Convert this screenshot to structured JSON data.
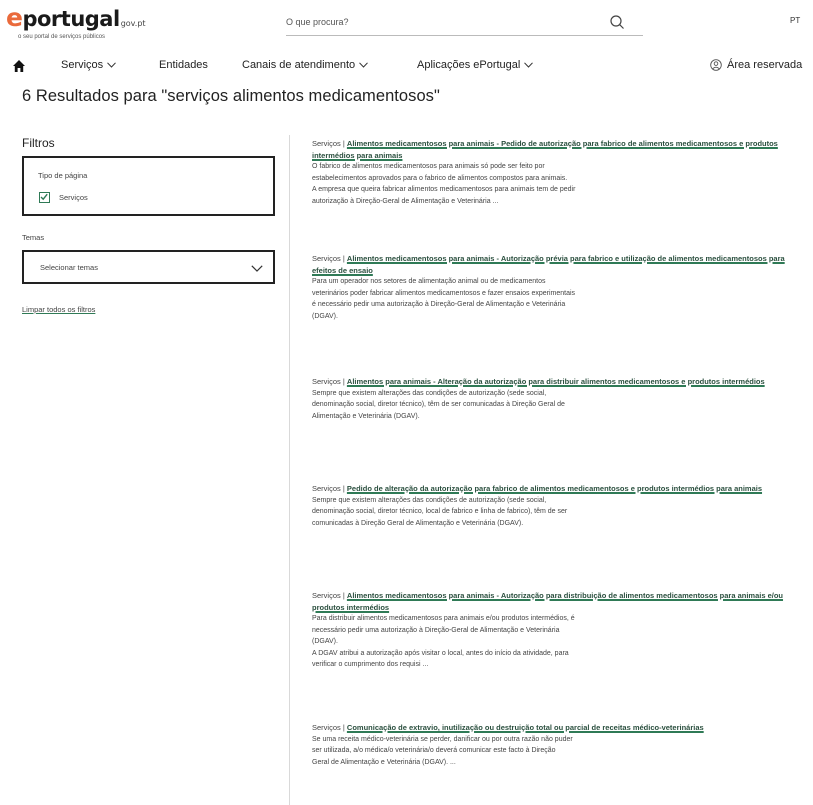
{
  "header": {
    "logo_e": "e",
    "logo_text": "portugal",
    "logo_suffix": "gov.pt",
    "logo_tagline": "o seu portal de serviços públicos",
    "search_placeholder": "O que procura?",
    "search_icon": "search-icon",
    "language": "PT"
  },
  "nav": {
    "home_icon": "home-icon",
    "items": [
      {
        "label": "Serviços",
        "has_dropdown": true
      },
      {
        "label": "Entidades",
        "has_dropdown": false
      },
      {
        "label": "Canais de atendimento",
        "has_dropdown": true
      },
      {
        "label": "Aplicações ePortugal",
        "has_dropdown": true
      }
    ],
    "reserved_area": "Área reservada",
    "reserved_icon": "user-icon"
  },
  "results_heading": "6 Resultados para \"serviços alimentos medicamentosos\"",
  "filters": {
    "title": "Filtros",
    "page_type_label": "Tipo de página",
    "page_type_option": "Serviços",
    "page_type_checked": true,
    "themes_label": "Temas",
    "themes_select": "Selecionar temas",
    "clear_all": "Limpar todos os filtros"
  },
  "results": [
    {
      "category": "Serviços",
      "separator": "|",
      "title": "Alimentos medicamentosos para animais - Pedido de autorização para fabrico de alimentos medicamentosos e produtos intermédios para animais",
      "description": "O fabrico de alimentos medicamentosos para animais só pode ser feito por\nestabelecimentos aprovados para o fabrico de alimentos compostos para animais.\nA empresa que queira fabricar alimentos medicamentosos para animais tem de pedir\nautorização à Direção-Geral de Alimentação e Veterinária ..."
    },
    {
      "category": "Serviços",
      "separator": "|",
      "title": "Alimentos medicamentosos para animais - Autorização prévia para fabrico e utilização de alimentos medicamentosos para efeitos de ensaio",
      "description": "Para um operador nos setores de alimentação animal ou de medicamentos\nveterinários poder fabricar alimentos medicamentosos e fazer ensaios experimentais\né necessário pedir uma autorização à Direção-Geral de Alimentação e Veterinária\n(DGAV)."
    },
    {
      "category": "Serviços",
      "separator": "|",
      "title": "Alimentos para animais - Alteração da autorização para distribuir alimentos medicamentosos e produtos intermédios",
      "description": "Sempre que existem alterações das condições de autorização (sede social,\ndenominação social, diretor técnico), têm de ser comunicadas à Direção Geral de\nAlimentação e Veterinária (DGAV)."
    },
    {
      "category": "Serviços",
      "separator": "|",
      "title": "Pedido de alteração da autorização para fabrico de alimentos medicamentosos e produtos intermédios para animais",
      "description": "Sempre que existem alterações das condições de autorização (sede social,\ndenominação social, diretor técnico, local de fabrico e linha de fabrico), têm de ser\ncomunicadas à Direção Geral de Alimentação e Veterinária (DGAV)."
    },
    {
      "category": "Serviços",
      "separator": "|",
      "title": "Alimentos medicamentosos para animais - Autorização para distribuição de alimentos medicamentosos para animais e/ou produtos intermédios",
      "description": "Para distribuir alimentos medicamentosos para animais e/ou produtos intermédios, é\nnecessário pedir uma autorização à Direção-Geral de Alimentação e Veterinária\n(DGAV).\nA DGAV atribui a autorização após visitar o local, antes do início da atividade, para\nverificar o cumprimento dos requisi ..."
    },
    {
      "category": "Serviços",
      "separator": "|",
      "title": "Comunicação de extravio, inutilização ou destruição total ou parcial de receitas médico-veterinárias",
      "description": "Se uma receita médico-veterinária se perder, danificar ou por outra razão não puder\nser utilizada, a/o médica/o veterinária/o deverá comunicar este facto à Direção\nGeral de Alimentação e Veterinária (DGAV). ..."
    }
  ],
  "colors": {
    "brand_orange": "#ea6a3b",
    "link_green": "#2f7a56",
    "text": "#333333"
  }
}
